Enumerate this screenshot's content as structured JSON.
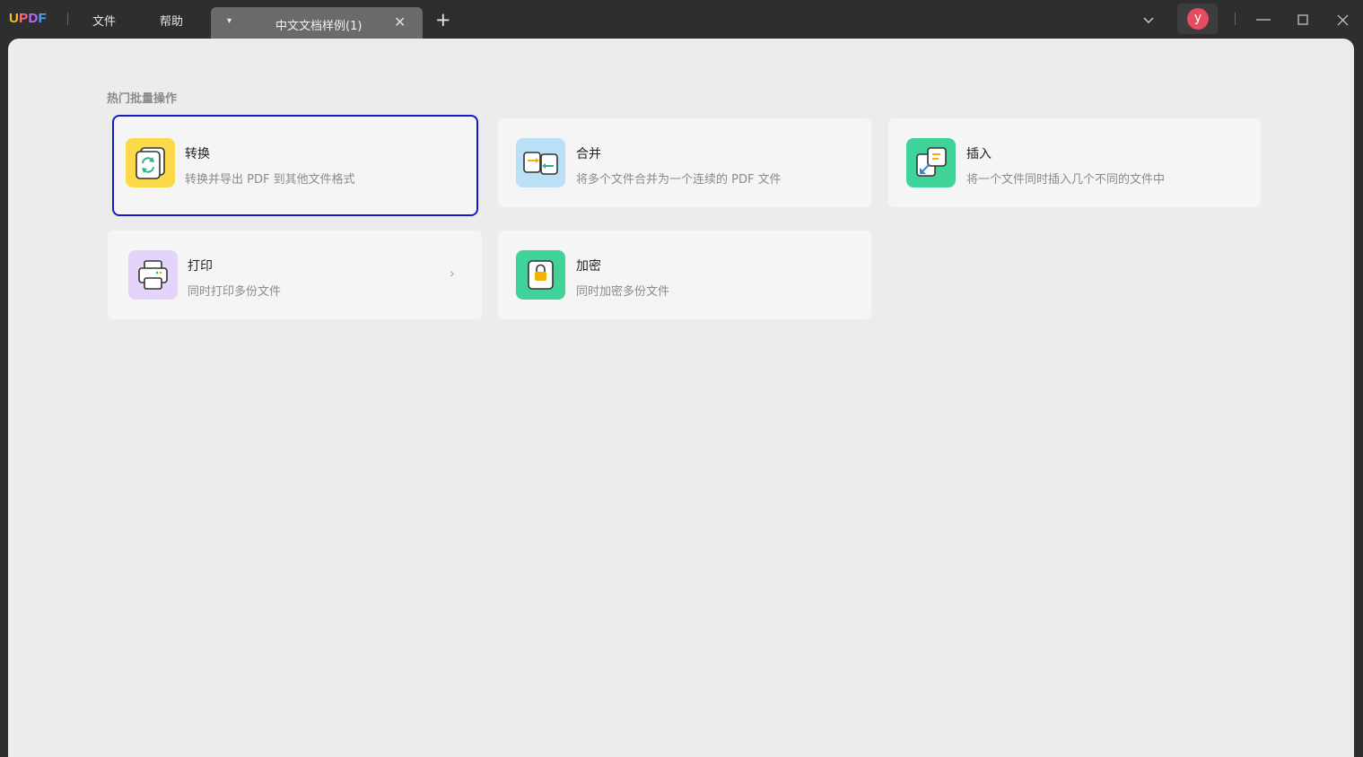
{
  "app": {
    "logo": {
      "u": "U",
      "p": "P",
      "d": "D",
      "f": "F"
    },
    "menu": {
      "file": "文件",
      "help": "帮助"
    },
    "tab": {
      "title": "中文文档样例(1)",
      "caret": "▾",
      "close": "✕"
    },
    "add_tab": "+",
    "avatar_letter": "y",
    "window": {
      "dropdown": "⌄",
      "minimize": "—",
      "maximize": "☐",
      "close": "✕"
    }
  },
  "main": {
    "section_title": "热门批量操作",
    "cards": [
      {
        "title": "转换",
        "desc": "转换并导出 PDF 到其他文件格式",
        "icon": "convert-icon",
        "color": "#fbd94a",
        "selected": true
      },
      {
        "title": "合并",
        "desc": "将多个文件合并为一个连续的 PDF 文件",
        "icon": "merge-icon",
        "color": "#b9e0f5"
      },
      {
        "title": "插入",
        "desc": "将一个文件同时插入几个不同的文件中",
        "icon": "insert-icon",
        "color": "#3fd39a"
      },
      {
        "title": "打印",
        "desc": "同时打印多份文件",
        "icon": "print-icon",
        "color": "#e4d4fb",
        "chevron": "›"
      },
      {
        "title": "加密",
        "desc": "同时加密多份文件",
        "icon": "lock-icon",
        "color": "#3fd39a"
      }
    ]
  },
  "colors": {
    "selection_outline": "#1818c8",
    "titlebar": "#2e2e2e",
    "content_bg": "#ececec",
    "card_bg": "#f5f5f5"
  }
}
